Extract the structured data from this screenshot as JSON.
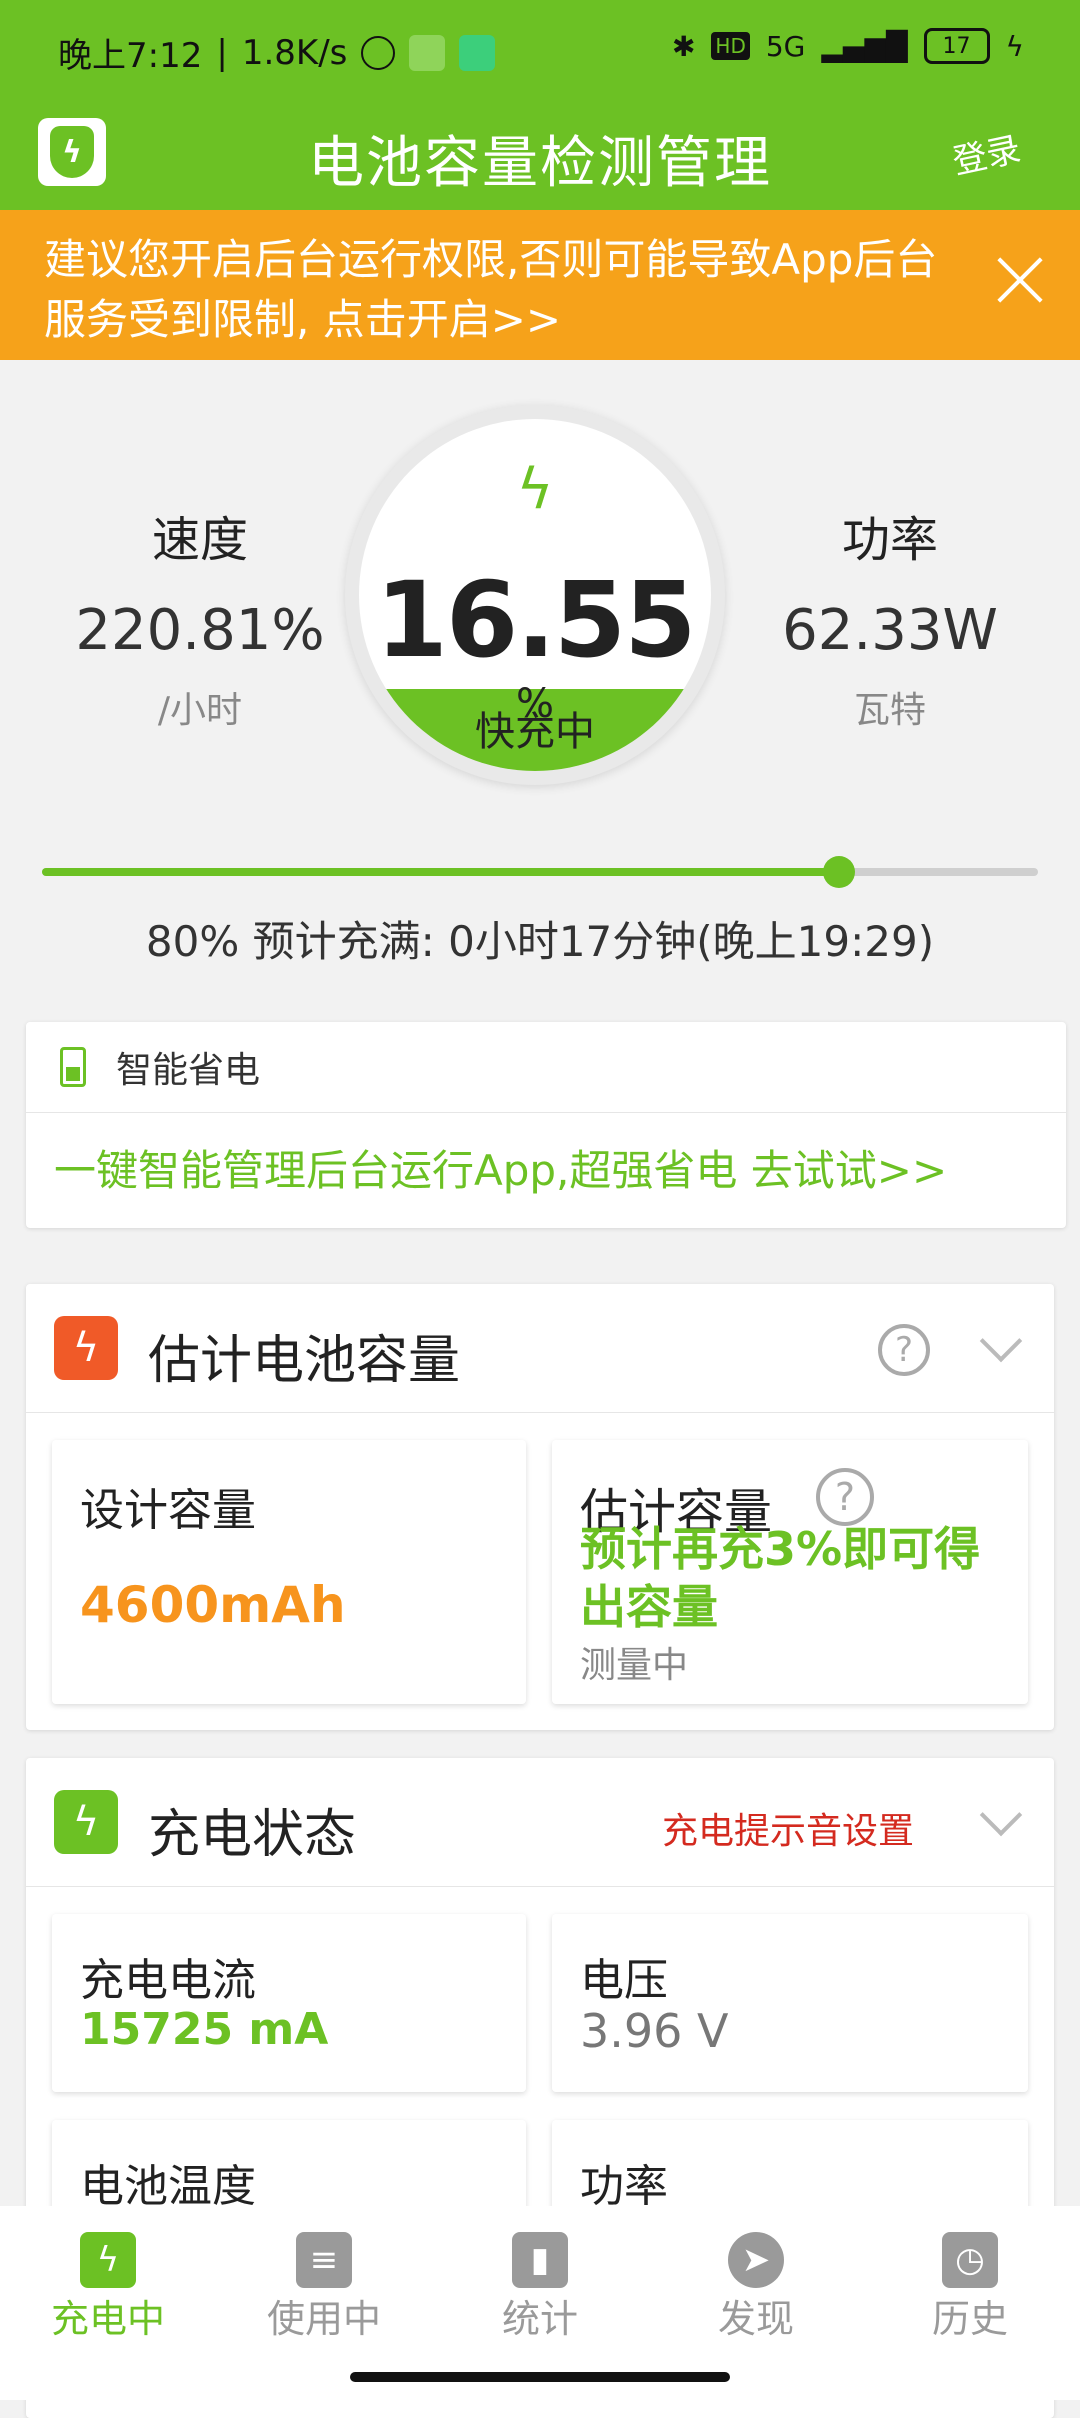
{
  "status_bar": {
    "time": "晚上7:12",
    "speed": "1.8K/s",
    "network": "5G",
    "battery": "17"
  },
  "app_bar": {
    "title": "电池容量检测管理",
    "login": "登录",
    "logo_icon": "shield-bolt-icon"
  },
  "notice": {
    "text": "建议您开启后台运行权限,否则可能导致App后台服务受到限制, 点击开启>>"
  },
  "stats": {
    "speed_label": "速度",
    "speed_value": "220.81%",
    "speed_unit": "/小时",
    "power_label": "功率",
    "power_value": "62.33W",
    "power_unit": "瓦特"
  },
  "gauge": {
    "value": "16.55",
    "percent": "%",
    "state": "快充中",
    "level": 0.1655
  },
  "progress": {
    "target_fraction": 0.8,
    "text": "80%  预计充满: 0小时17分钟(晚上19:29)"
  },
  "smart_save": {
    "title": "智能省电",
    "body": "一键智能管理后台运行App,超强省电   去试试>>"
  },
  "capacity": {
    "title": "估计电池容量",
    "design_label": "设计容量",
    "design_value": "4600mAh",
    "estimate_label": "估计容量",
    "estimate_msg": "预计再充3%即可得出容量",
    "estimate_sub": "测量中"
  },
  "charge_state": {
    "title": "充电状态",
    "tone_link": "充电提示音设置",
    "current_label": "充电电流",
    "current_value": "15725 mA",
    "voltage_label": "电压",
    "voltage_value": "3.96 V",
    "temp_label": "电池温度",
    "power_label": "功率"
  },
  "bottom_nav": {
    "items": [
      {
        "label": "充电中",
        "icon": "battery-charging-icon"
      },
      {
        "label": "使用中",
        "icon": "battery-icon"
      },
      {
        "label": "统计",
        "icon": "bar-chart-icon"
      },
      {
        "label": "发现",
        "icon": "compass-icon"
      },
      {
        "label": "历史",
        "icon": "clock-icon"
      }
    ]
  },
  "colors": {
    "brand_green": "#6cc124",
    "notice_orange": "#f6a21a",
    "value_orange": "#f7941d",
    "link_red": "#d42a1f"
  }
}
